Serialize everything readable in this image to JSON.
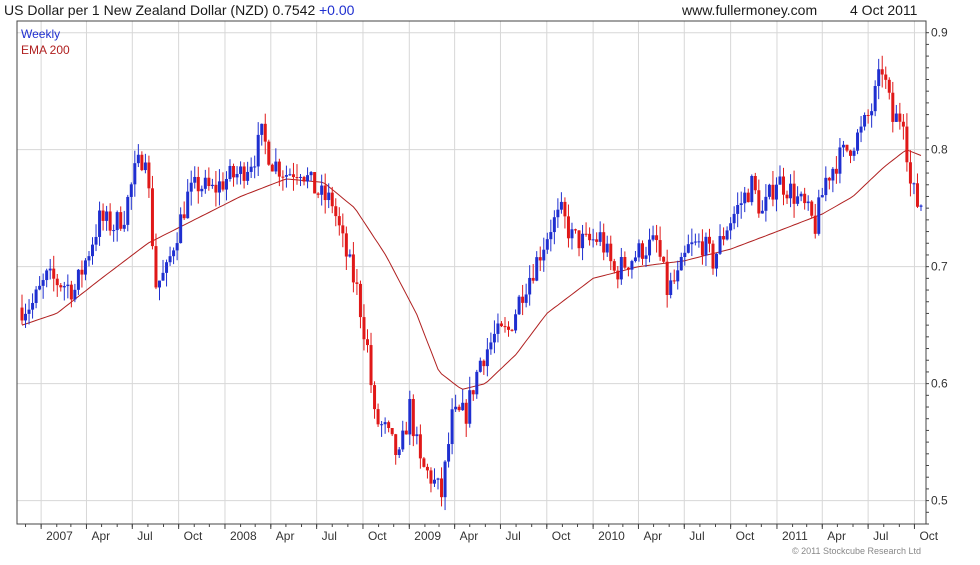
{
  "header": {
    "title": "US Dollar per 1 New Zealand Dollar (NZD) 0.7542",
    "change": "+0.00",
    "site": "www.fullermoney.com",
    "date": "4 Oct 2011"
  },
  "copyright": "© 2011 Stockcube Research Ltd",
  "colors": {
    "up": "#1f2fd0",
    "down": "#e01818",
    "ema": "#b02020",
    "grid": "#d7d7d7",
    "frame": "#444444"
  },
  "chart_data": {
    "type": "candlestick",
    "frequency_label": "Weekly",
    "ema_label": "EMA 200",
    "y_ticks": [
      0.5,
      0.6,
      0.7,
      0.8,
      0.9
    ],
    "ylim": [
      0.48,
      0.91
    ],
    "x_labels": [
      "2007",
      "Apr",
      "Jul",
      "Oct",
      "2008",
      "Apr",
      "Jul",
      "Oct",
      "2009",
      "Apr",
      "Jul",
      "Oct",
      "2010",
      "Apr",
      "Jul",
      "Oct",
      "2011",
      "Apr",
      "Jul",
      "Oct"
    ],
    "x_range": [
      "2006-11-24",
      "2011-10-14"
    ],
    "grid": true,
    "close_path": [
      [
        "2006-11-24",
        0.665
      ],
      [
        "2006-12-15",
        0.668
      ],
      [
        "2007-01-12",
        0.69
      ],
      [
        "2007-02-16",
        0.685
      ],
      [
        "2007-03-09",
        0.68
      ],
      [
        "2007-03-30",
        0.705
      ],
      [
        "2007-04-27",
        0.74
      ],
      [
        "2007-05-25",
        0.735
      ],
      [
        "2007-06-15",
        0.745
      ],
      [
        "2007-07-06",
        0.78
      ],
      [
        "2007-07-27",
        0.8
      ],
      [
        "2007-08-17",
        0.685
      ],
      [
        "2007-09-07",
        0.695
      ],
      [
        "2007-09-21",
        0.72
      ],
      [
        "2007-10-19",
        0.76
      ],
      [
        "2007-11-09",
        0.77
      ],
      [
        "2007-12-07",
        0.765
      ],
      [
        "2008-01-04",
        0.775
      ],
      [
        "2008-02-01",
        0.78
      ],
      [
        "2008-02-29",
        0.795
      ],
      [
        "2008-03-14",
        0.812
      ],
      [
        "2008-04-04",
        0.79
      ],
      [
        "2008-05-02",
        0.78
      ],
      [
        "2008-05-30",
        0.785
      ],
      [
        "2008-06-20",
        0.77
      ],
      [
        "2008-07-11",
        0.76
      ],
      [
        "2008-08-01",
        0.755
      ],
      [
        "2008-08-22",
        0.72
      ],
      [
        "2008-09-19",
        0.68
      ],
      [
        "2008-10-10",
        0.63
      ],
      [
        "2008-10-24",
        0.57
      ],
      [
        "2008-11-14",
        0.56
      ],
      [
        "2008-12-12",
        0.535
      ],
      [
        "2009-01-02",
        0.58
      ],
      [
        "2009-01-23",
        0.53
      ],
      [
        "2009-02-13",
        0.52
      ],
      [
        "2009-03-06",
        0.505
      ],
      [
        "2009-03-27",
        0.57
      ],
      [
        "2009-04-24",
        0.575
      ],
      [
        "2009-05-22",
        0.62
      ],
      [
        "2009-06-19",
        0.64
      ],
      [
        "2009-07-17",
        0.645
      ],
      [
        "2009-08-14",
        0.68
      ],
      [
        "2009-09-11",
        0.705
      ],
      [
        "2009-10-09",
        0.735
      ],
      [
        "2009-10-30",
        0.745
      ],
      [
        "2009-11-20",
        0.725
      ],
      [
        "2009-12-18",
        0.72
      ],
      [
        "2010-01-15",
        0.725
      ],
      [
        "2010-02-12",
        0.695
      ],
      [
        "2010-03-12",
        0.705
      ],
      [
        "2010-04-09",
        0.715
      ],
      [
        "2010-05-07",
        0.72
      ],
      [
        "2010-05-28",
        0.68
      ],
      [
        "2010-06-18",
        0.69
      ],
      [
        "2010-07-09",
        0.715
      ],
      [
        "2010-08-06",
        0.72
      ],
      [
        "2010-08-27",
        0.705
      ],
      [
        "2010-09-24",
        0.735
      ],
      [
        "2010-10-22",
        0.755
      ],
      [
        "2010-11-12",
        0.77
      ],
      [
        "2010-12-03",
        0.745
      ],
      [
        "2010-12-31",
        0.775
      ],
      [
        "2011-01-28",
        0.765
      ],
      [
        "2011-02-25",
        0.75
      ],
      [
        "2011-03-18",
        0.735
      ],
      [
        "2011-04-08",
        0.775
      ],
      [
        "2011-04-29",
        0.79
      ],
      [
        "2011-05-20",
        0.8
      ],
      [
        "2011-06-17",
        0.815
      ],
      [
        "2011-07-08",
        0.835
      ],
      [
        "2011-07-29",
        0.87
      ],
      [
        "2011-08-19",
        0.825
      ],
      [
        "2011-09-09",
        0.83
      ],
      [
        "2011-09-23",
        0.77
      ],
      [
        "2011-10-07",
        0.7542
      ]
    ],
    "ema_path": [
      [
        "2006-11-24",
        0.65
      ],
      [
        "2007-02-01",
        0.66
      ],
      [
        "2007-05-01",
        0.69
      ],
      [
        "2007-08-01",
        0.72
      ],
      [
        "2007-11-01",
        0.74
      ],
      [
        "2008-02-01",
        0.76
      ],
      [
        "2008-05-01",
        0.775
      ],
      [
        "2008-07-15",
        0.772
      ],
      [
        "2008-09-15",
        0.75
      ],
      [
        "2008-11-15",
        0.71
      ],
      [
        "2009-01-15",
        0.66
      ],
      [
        "2009-03-01",
        0.61
      ],
      [
        "2009-04-15",
        0.595
      ],
      [
        "2009-06-01",
        0.6
      ],
      [
        "2009-08-01",
        0.625
      ],
      [
        "2009-10-01",
        0.66
      ],
      [
        "2010-01-01",
        0.69
      ],
      [
        "2010-04-01",
        0.7
      ],
      [
        "2010-07-01",
        0.705
      ],
      [
        "2010-10-01",
        0.715
      ],
      [
        "2011-01-01",
        0.73
      ],
      [
        "2011-04-01",
        0.745
      ],
      [
        "2011-06-01",
        0.76
      ],
      [
        "2011-08-01",
        0.785
      ],
      [
        "2011-09-15",
        0.8
      ],
      [
        "2011-10-14",
        0.795
      ]
    ]
  }
}
